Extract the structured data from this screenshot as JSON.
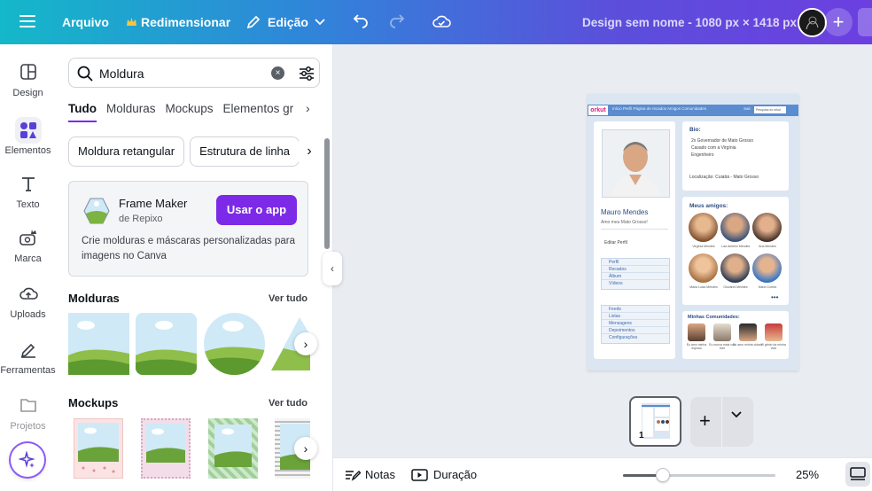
{
  "topbar": {
    "arquivo": "Arquivo",
    "redimensionar": "Redimensionar",
    "edicao": "Edição",
    "title": "Design sem nome - 1080 px × 1418 px"
  },
  "rail": {
    "items": [
      "Design",
      "Elementos",
      "Texto",
      "Marca",
      "Uploads",
      "Ferramentas",
      "Projetos"
    ]
  },
  "search": {
    "value": "Moldura"
  },
  "tabs": [
    "Tudo",
    "Molduras",
    "Mockups",
    "Elementos gr"
  ],
  "chips": [
    "Moldura retangular",
    "Estrutura de linha"
  ],
  "frame_maker": {
    "title": "Frame Maker",
    "subtitle": "de Repixo",
    "button": "Usar o app",
    "description": "Crie molduras e máscaras personalizadas para imagens no Canva"
  },
  "sections": {
    "molduras": {
      "title": "Molduras",
      "link": "Ver tudo"
    },
    "mockups": {
      "title": "Mockups",
      "link": "Ver tudo"
    }
  },
  "design": {
    "logo": "orkut",
    "nav": "Início    Perfil    Página de recados    Amigos    Comunidades",
    "nav_right": "Sair",
    "search": "Pesquisa do orkut",
    "bio_title": "Bio:",
    "bio_lines": [
      "2x Governador de Mato Grosso",
      "Casado com a Virgínia",
      "Engenheiro"
    ],
    "location": "Localização: Cuiabá - Mato Grosso",
    "name": "Mauro Mendes",
    "tagline": "Amo meu Mato Grosso!",
    "edit_profile": "Editar Perfil",
    "menu1": [
      "Perfil",
      "Recados",
      "Álbum",
      "Vídeos"
    ],
    "menu2": [
      "Feeds",
      "Listas",
      "Mensagens",
      "Depoimentos",
      "Configurações"
    ],
    "friends_title": "Meus amigos:",
    "friends": [
      "Virgínia Mendes",
      "Luiz Antônio Mendes",
      "Ana Mendes",
      "Maria Luiza Mendes",
      "Giovanni Mendes",
      "Mário Corrêa"
    ],
    "communities_title": "Minhas Comunidades:",
    "communities": [
      "Eu amo minha esposa",
      "Eu nunca mais vou trair",
      "Eu amo minha cidade",
      "O gênio da minha vida"
    ]
  },
  "pages": {
    "current": "1"
  },
  "bottombar": {
    "notas": "Notas",
    "duracao": "Duração",
    "zoom": "25%",
    "zoom_level": 0.26
  }
}
